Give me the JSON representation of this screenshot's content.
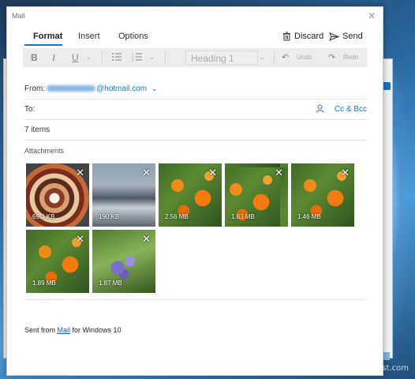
{
  "window": {
    "title": "Mail",
    "close_glyph": "✕"
  },
  "tabs": [
    {
      "label": "Format",
      "active": true
    },
    {
      "label": "Insert",
      "active": false
    },
    {
      "label": "Options",
      "active": false
    }
  ],
  "actions": {
    "discard_label": "Discard",
    "send_label": "Send"
  },
  "toolbar": {
    "bold": "B",
    "italic": "I",
    "underline": "U",
    "heading_value": "Heading 1",
    "undo_label": "Undo",
    "redo_label": "Redo"
  },
  "from": {
    "label": "From:",
    "address": "@hotmail.com"
  },
  "to": {
    "label": "To:",
    "cc_bcc_label": "Cc & Bcc"
  },
  "subject": {
    "value": "7 items"
  },
  "attachments": {
    "label": "Attachments",
    "items": [
      {
        "size": "69.4 KB",
        "image": "cake-slices"
      },
      {
        "size": "190 KB",
        "image": "crowd-street"
      },
      {
        "size": "2.56 MB",
        "image": "orange-flowers"
      },
      {
        "size": "1.83 MB",
        "image": "orange-flowers"
      },
      {
        "size": "1.46 MB",
        "image": "orange-flowers"
      },
      {
        "size": "1.89 MB",
        "image": "orange-flowers"
      },
      {
        "size": "1.87 MB",
        "image": "purple-flowers"
      }
    ]
  },
  "signature": {
    "prefix": "Sent from ",
    "link": "Mail",
    "suffix": " for Windows 10"
  },
  "watermark": "groovyPost.com",
  "colors": {
    "accent": "#1e73be",
    "link": "#1e55c8",
    "toolbar_bg": "#ececec"
  }
}
